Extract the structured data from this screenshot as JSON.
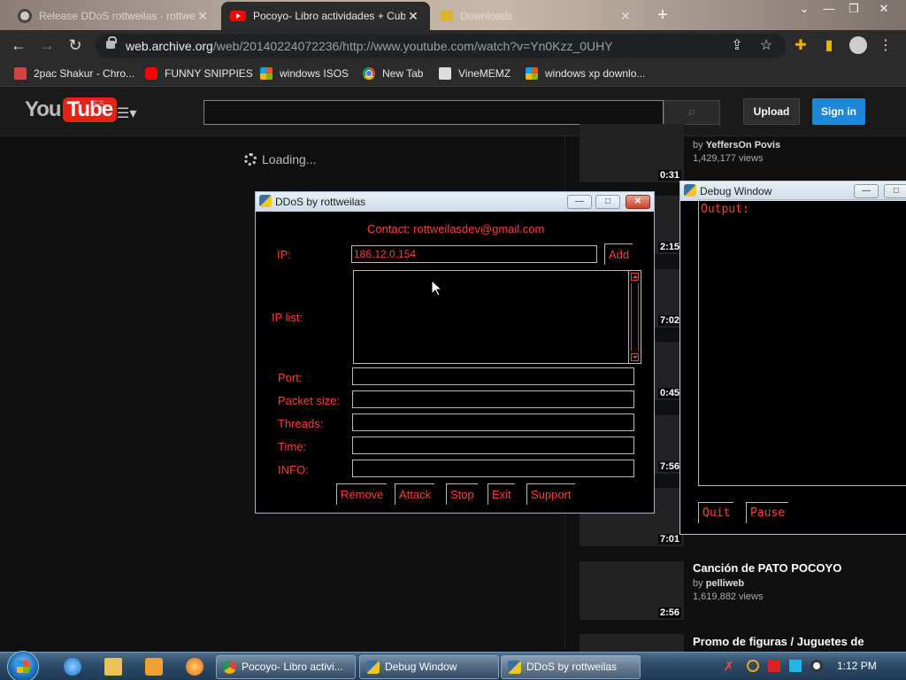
{
  "browser": {
    "tabs": [
      {
        "title": "Release DDoS rottweilas · rottwe",
        "state": "inactive"
      },
      {
        "title": "Pocoyo- Libro actividades + Cub",
        "state": "active"
      },
      {
        "title": "Downloads",
        "state": "inactive"
      }
    ],
    "url_host": "web.archive.org",
    "url_path": "/web/20140224072236/http://www.youtube.com/watch?v=Yn0Kzz_0UHY",
    "bookmarks": [
      {
        "label": "2pac Shakur - Chro...",
        "icon": "gift-icon"
      },
      {
        "label": "FUNNY SNIPPIES",
        "icon": "youtube-icon"
      },
      {
        "label": "windows ISOS",
        "icon": "windows-icon"
      },
      {
        "label": "New Tab",
        "icon": "chrome-icon"
      },
      {
        "label": "VineMEMZ",
        "icon": "vine-icon"
      },
      {
        "label": "windows xp downlo...",
        "icon": "windows-icon"
      }
    ]
  },
  "youtube": {
    "logo_you": "You",
    "logo_tube": "Tube",
    "region": "ES",
    "upload_label": "Upload",
    "signin_label": "Sign in",
    "loading_text": "Loading...",
    "sidebar": [
      {
        "duration": "0:31",
        "title": "",
        "by_prefix": "by",
        "channel": "YeffersOn Povis",
        "views": "1,429,177 views"
      },
      {
        "duration": "2:15"
      },
      {
        "duration": "7:02"
      },
      {
        "duration": "0:45"
      },
      {
        "duration": "7:56"
      },
      {
        "duration": "7:01"
      },
      {
        "duration": "2:56",
        "title": "Canción de PATO POCOYO",
        "by_prefix": "by",
        "channel": "pelliweb",
        "views": "1,619,882 views"
      },
      {
        "duration": "",
        "title": "Promo de figuras / Juguetes de"
      }
    ]
  },
  "ddos_window": {
    "title": "DDoS by rottweilas",
    "contact": "Contact: rottweilasdev@gmail.com",
    "ip_label": "IP:",
    "ip_value": "186.12.0.154",
    "add_label": "Add",
    "ip_list_label": "IP list:",
    "port_label": "Port:",
    "packet_size_label": "Packet size:",
    "threads_label": "Threads:",
    "time_label": "Time:",
    "info_label": "INFO:",
    "buttons": {
      "remove": "Remove",
      "attack": "Attack",
      "stop": "Stop",
      "exit": "Exit",
      "support": "Support"
    }
  },
  "debug_window": {
    "title": "Debug Window",
    "output_label": "Output:",
    "quit_label": "Quit",
    "pause_label": "Pause"
  },
  "taskbar": {
    "buttons": [
      {
        "label": "Pocoyo- Libro activi...",
        "icon": "chrome-icon"
      },
      {
        "label": "Debug Window",
        "icon": "python-icon"
      },
      {
        "label": "DDoS by rottweilas",
        "icon": "python-icon"
      }
    ],
    "clock": "1:12 PM"
  },
  "colors": {
    "accent_red": "#ff3b3b",
    "youtube_red": "#e62117",
    "signin_blue": "#1e88d8"
  }
}
